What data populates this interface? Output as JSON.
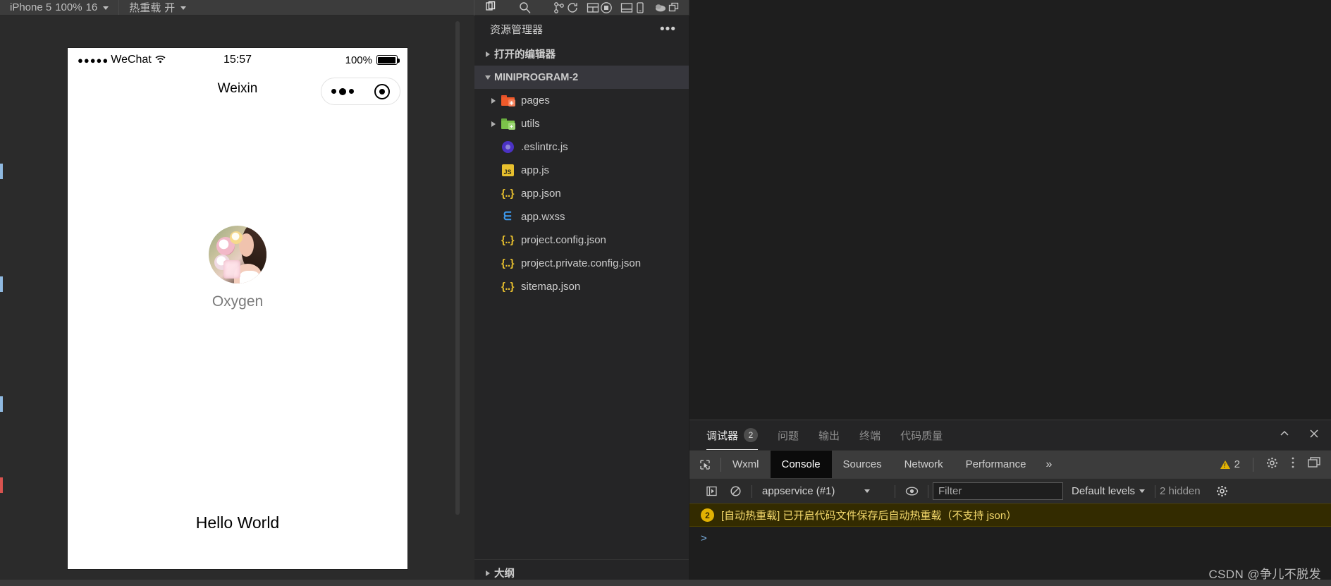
{
  "toolbar": {
    "simulator_device": "iPhone 5",
    "simulator_zoom": "100%",
    "simulator_font": "16",
    "hotreload_label": "热重载",
    "compile_label": "开",
    "icons": [
      "refresh-icon",
      "stop-icon",
      "device-icon",
      "copy-icon",
      "explorer-icon",
      "search-icon",
      "source-control-icon",
      "layout-icon",
      "debug-panel-icon",
      "cloud-icon"
    ]
  },
  "simulator": {
    "statusbar": {
      "signal_dots": "●●●●●",
      "carrier": "WeChat",
      "wifi": "wifi-icon",
      "time": "15:57",
      "battery_percent": "100%"
    },
    "navbar": {
      "title": "Weixin",
      "capsule_menu": "more-dots-icon",
      "capsule_close": "target-circle-icon"
    },
    "page": {
      "avatar_alt": "user-avatar",
      "nickname": "Oxygen",
      "hello_text": "Hello World"
    }
  },
  "explorer": {
    "title": "资源管理器",
    "more_label": "•••",
    "sections": [
      {
        "label": "打开的编辑器",
        "expanded": false
      },
      {
        "label": "MINIPROGRAM-2",
        "expanded": true
      }
    ],
    "outline_label": "大纲",
    "files": [
      {
        "label": "pages",
        "icon": "folder-red",
        "type": "folder",
        "indent": 1,
        "expanded": false
      },
      {
        "label": "utils",
        "icon": "folder-green",
        "type": "folder",
        "indent": 1,
        "expanded": false
      },
      {
        "label": ".eslintrc.js",
        "icon": "eslint",
        "type": "file",
        "indent": 1
      },
      {
        "label": "app.js",
        "icon": "js",
        "type": "file",
        "indent": 1
      },
      {
        "label": "app.json",
        "icon": "json",
        "type": "file",
        "indent": 1
      },
      {
        "label": "app.wxss",
        "icon": "css",
        "type": "file",
        "indent": 1
      },
      {
        "label": "project.config.json",
        "icon": "json",
        "type": "file",
        "indent": 1
      },
      {
        "label": "project.private.config.json",
        "icon": "json",
        "type": "file",
        "indent": 1
      },
      {
        "label": "sitemap.json",
        "icon": "json",
        "type": "file",
        "indent": 1
      }
    ]
  },
  "devtools": {
    "panel_tabs": [
      {
        "label": "调试器",
        "badge": "2",
        "active": true
      },
      {
        "label": "问题",
        "badge": "",
        "active": false
      },
      {
        "label": "输出",
        "badge": "",
        "active": false
      },
      {
        "label": "终端",
        "badge": "",
        "active": false
      },
      {
        "label": "代码质量",
        "badge": "",
        "active": false
      }
    ],
    "panel_actions": [
      "chevron-up-icon",
      "close-icon"
    ],
    "chrome_tabs": [
      {
        "label": "Wxml",
        "active": false
      },
      {
        "label": "Console",
        "active": true
      },
      {
        "label": "Sources",
        "active": false
      },
      {
        "label": "Network",
        "active": false
      },
      {
        "label": "Performance",
        "active": false
      }
    ],
    "chrome_more": "»",
    "warning_count": "2",
    "console": {
      "execute_icon": "step-into-icon",
      "clear_icon": "clear-console-icon",
      "context": "appservice (#1)",
      "eye_icon": "live-expression-icon",
      "filter_placeholder": "Filter",
      "filter_value": "",
      "levels_label": "Default levels",
      "hidden_label": "2 hidden",
      "settings_icon": "gear-icon",
      "messages": [
        {
          "badge": "2",
          "text": "[自动热重载] 已开启代码文件保存后自动热重载（不支持 json）",
          "level": "warning"
        }
      ],
      "prompt": ">"
    }
  },
  "watermark": "CSDN @争儿不脱发",
  "colors": {
    "accent_yellow": "#e2b203",
    "panel_bg": "#252526",
    "editor_bg": "#1e1e1e",
    "toolbar_bg": "#3c3c3c"
  }
}
